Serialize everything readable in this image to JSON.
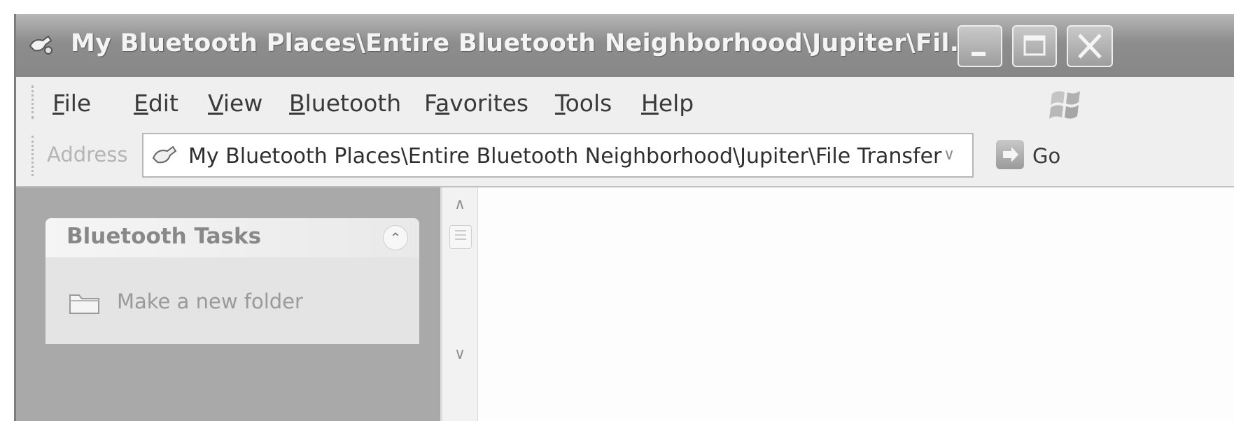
{
  "window": {
    "title": "My Bluetooth Places\\Entire Bluetooth Neighborhood\\Jupiter\\Fil...",
    "buttons": [
      "minimize",
      "maximize",
      "close"
    ]
  },
  "menu": {
    "items": [
      {
        "label": "File",
        "accel": "F"
      },
      {
        "label": "Edit",
        "accel": "E"
      },
      {
        "label": "View",
        "accel": "V"
      },
      {
        "label": "Bluetooth",
        "accel": "B"
      },
      {
        "label": "Favorites",
        "accel": "a"
      },
      {
        "label": "Tools",
        "accel": "T"
      },
      {
        "label": "Help",
        "accel": "H"
      }
    ]
  },
  "address": {
    "label": "Address",
    "value": "My Bluetooth Places\\Entire Bluetooth Neighborhood\\Jupiter\\File Transfer",
    "go_label": "Go"
  },
  "tasks": {
    "title": "Bluetooth Tasks",
    "items": [
      {
        "label": "Make a new folder",
        "icon": "folder-icon"
      }
    ]
  },
  "colors": {
    "titlebar": "#8d8d8d",
    "taskpane": "#a9a9a9",
    "content": "#fdfdfd"
  }
}
